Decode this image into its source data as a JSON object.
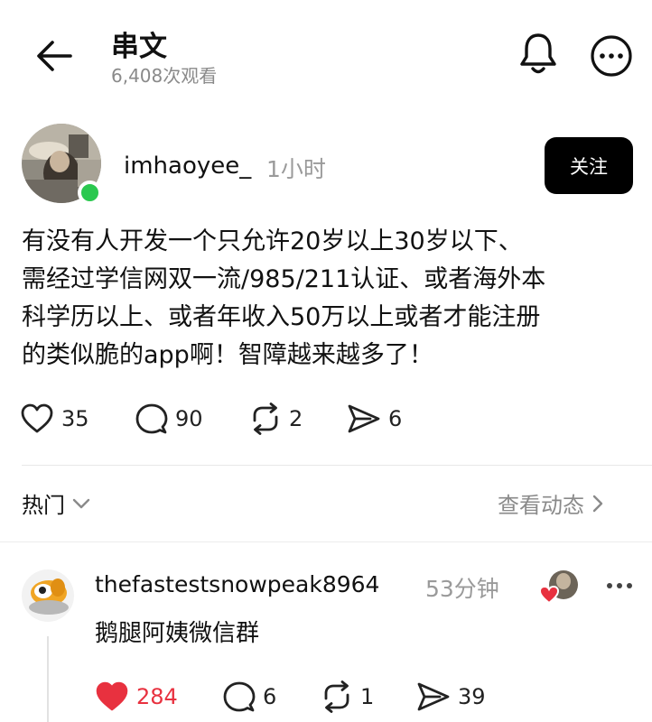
{
  "header": {
    "title": "串文",
    "views": "6,408次观看",
    "back_icon": "back-arrow-icon",
    "bell_icon": "bell-icon",
    "more_icon": "more-circle-icon"
  },
  "post": {
    "username": "imhaoyee_",
    "time": "1小时",
    "follow_label": "关注",
    "online": true,
    "body_lines": [
      "有没有人开发一个只允许20岁以上30岁以下、",
      "需经过学信网双一流/985/211认证、或者海外本",
      "科学历以上、或者年收入50万以上或者才能注册",
      "的类似脆的app啊！智障越来越多了！"
    ],
    "stats": {
      "likes": "35",
      "replies": "90",
      "reposts": "2",
      "shares": "6"
    }
  },
  "sort": {
    "label": "热门",
    "activity_label": "查看动态"
  },
  "reply": {
    "username": "thefastestsnowpeak8964",
    "time": "53分钟",
    "text": "鹅腿阿姨微信群",
    "stats": {
      "likes": "284",
      "replies": "6",
      "reposts": "1",
      "shares": "39"
    },
    "liked": true
  },
  "colors": {
    "like_red": "#e8313f",
    "online_green": "#2ac84f",
    "muted_text": "#8a8a8a"
  }
}
